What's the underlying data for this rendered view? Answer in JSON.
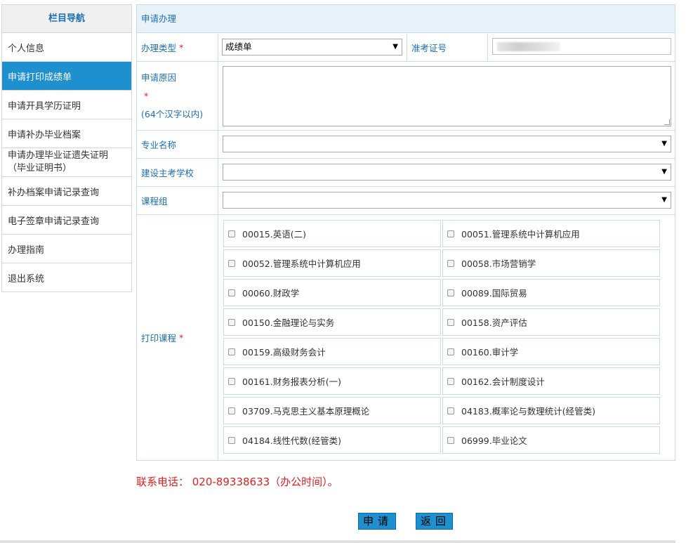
{
  "sidebar": {
    "title": "栏目导航",
    "items": [
      {
        "label": "个人信息"
      },
      {
        "label": "申请打印成绩单"
      },
      {
        "label": "申请开具学历证明"
      },
      {
        "label": "申请补办毕业档案"
      },
      {
        "label_line1": "申请办理毕业证遗失证明",
        "label_line2": "（毕业证明书）"
      },
      {
        "label": "补办档案申请记录查询"
      },
      {
        "label": "电子签章申请记录查询"
      },
      {
        "label": "办理指南"
      },
      {
        "label": "退出系统"
      }
    ]
  },
  "form": {
    "title": "申请办理",
    "type_label": "办理类型",
    "type_value": "成绩单",
    "exam_no_label": "准考证号",
    "reason_label": "申请原因",
    "reason_hint": "(64个汉字以内)",
    "major_label": "专业名称",
    "school_label": "建设主考学校",
    "group_label": "课程组",
    "courses_label": "打印课程",
    "required_mark": "*",
    "courses": [
      "00015.英语(二)",
      "00051.管理系统中计算机应用",
      "00052.管理系统中计算机应用",
      "00058.市场营销学",
      "00060.财政学",
      "00089.国际贸易",
      "00150.金融理论与实务",
      "00158.资产评估",
      "00159.高级财务会计",
      "00160.审计学",
      "00161.财务报表分析(一)",
      "00162.会计制度设计",
      "03709.马克思主义基本原理概论",
      "04183.概率论与数理统计(经管类)",
      "04184.线性代数(经管类)",
      "06999.毕业论文"
    ]
  },
  "contact": "联系电话： 020-89338633（办公时间）。",
  "buttons": {
    "apply": "申请",
    "back": "返回"
  },
  "colors": {
    "accent": "#1e8fcf",
    "label": "#1c6fb5",
    "required": "#e02020"
  }
}
